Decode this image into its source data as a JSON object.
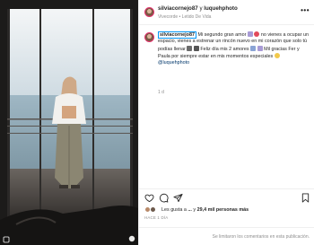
{
  "post": {
    "author": "silviacornejo87",
    "collaborator": "luquehphoto",
    "separator": "y",
    "location": "Vivecorde • Letido De Vida",
    "more_label": "•••"
  },
  "caption": {
    "username_tag": "silviacornejo87",
    "text_part1": "Mi segundo gran amor",
    "text_part2": "no vienes a ocupar un espacio, vienes a estrenar un rincón nuevo en mi corazón que solo tú podías llenar",
    "text_part3": "Feliz día mis 2 amores",
    "text_part4": "Mil gracias Fer y Paula por siempre estar en mis momentos especiales",
    "mention": "@luquehphoto",
    "time": "1 d"
  },
  "likes": {
    "prefix": "Les gusta a",
    "names": "...",
    "connector": "y",
    "count": "29,4 mil personas más"
  },
  "date": "HACE 1 DÍA",
  "footer": {
    "comments_disabled": "Se limitaron los comentarios en esta publicación."
  },
  "icons": {
    "like": "heart-icon",
    "comment": "comment-icon",
    "share": "paper-plane-icon",
    "save": "bookmark-icon",
    "more": "more-dots-icon"
  },
  "colors": {
    "link": "#00376b",
    "tag_border": "#0095f6",
    "muted": "#8e8e8e"
  }
}
